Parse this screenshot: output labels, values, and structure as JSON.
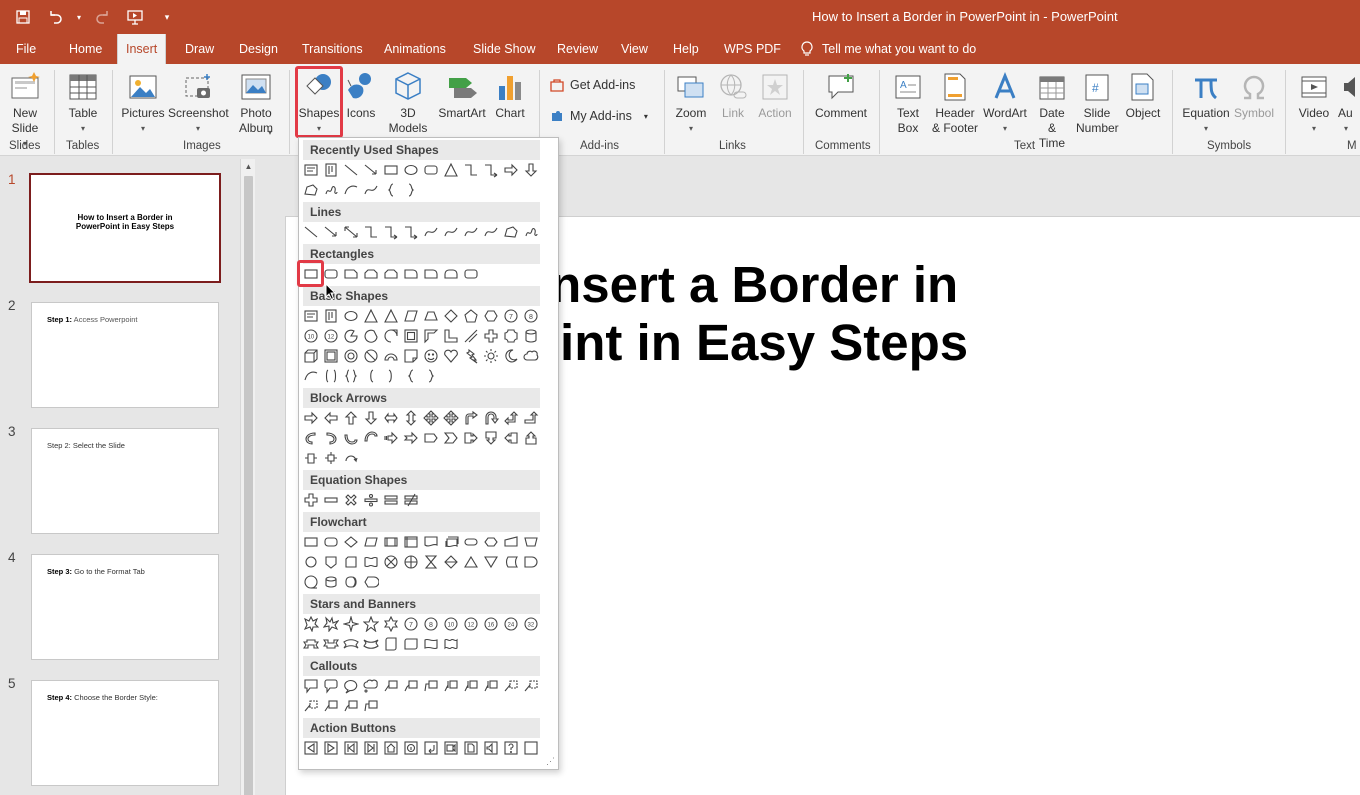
{
  "window": {
    "title": "How to Insert a Border in PowerPoint in  -  PowerPoint"
  },
  "tabs": [
    "File",
    "Home",
    "Insert",
    "Draw",
    "Design",
    "Transitions",
    "Animations",
    "Slide Show",
    "Review",
    "View",
    "Help",
    "WPS PDF"
  ],
  "active_tab": "Insert",
  "tell_me": "Tell me what you want to do",
  "ribbon": {
    "new_slide": "New Slide",
    "table": "Table",
    "pictures": "Pictures",
    "screenshot": "Screenshot",
    "photo_album": "Photo Album",
    "shapes": "Shapes",
    "icons": "Icons",
    "models_3d": "3D Models",
    "smartart": "SmartArt",
    "chart": "Chart",
    "get_addins": "Get Add-ins",
    "my_addins": "My Add-ins",
    "zoom": "Zoom",
    "link": "Link",
    "action": "Action",
    "comment": "Comment",
    "text_box": "Text Box",
    "header_footer": "Header & Footer",
    "wordart": "WordArt",
    "date_time": "Date & Time",
    "slide_number": "Slide Number",
    "object": "Object",
    "equation": "Equation",
    "symbol": "Symbol",
    "video": "Video",
    "audio": "Au",
    "groups": {
      "slides": "Slides",
      "tables": "Tables",
      "images": "Images",
      "addins": "Add-ins",
      "links": "Links",
      "comments": "Comments",
      "text": "Text",
      "symbols": "Symbols",
      "media": "M"
    }
  },
  "shape_categories": {
    "recent": "Recently Used Shapes",
    "lines": "Lines",
    "rectangles": "Rectangles",
    "basic": "Basic Shapes",
    "block_arrows": "Block Arrows",
    "equation": "Equation Shapes",
    "flowchart": "Flowchart",
    "stars": "Stars and Banners",
    "callouts": "Callouts",
    "action": "Action Buttons"
  },
  "slides": [
    {
      "num": "1",
      "title": "How to Insert a Border in PowerPoint in Easy Steps"
    },
    {
      "num": "2",
      "step_bold": "Step 1:",
      "step_rest": " Access Powerpoint"
    },
    {
      "num": "3",
      "step_bold": "",
      "step_rest": "Step 2: Select the Slide"
    },
    {
      "num": "4",
      "step_bold": "Step 3:",
      "step_rest": " Go to the Format Tab"
    },
    {
      "num": "5",
      "step_bold": "Step 4:",
      "step_rest": " Choose the Border Style:"
    }
  ],
  "current_slide": {
    "title_line1": "How to Insert a Border in",
    "title_line2": "PowerPoint in Easy Steps"
  }
}
